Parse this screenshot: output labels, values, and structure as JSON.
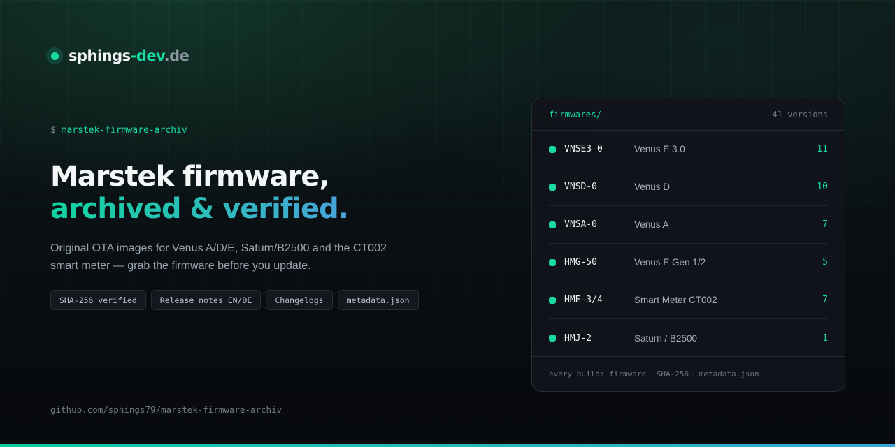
{
  "brand": {
    "part1": "sphings",
    "part2": "-dev",
    "part3": ".de"
  },
  "prompt": {
    "sign": "$",
    "command": "marstek-firmware-archiv"
  },
  "headline": {
    "line1": "Marstek firmware,",
    "line2": "archived & verified."
  },
  "lede": "Original OTA images for Venus A/D/E, Saturn/B2500 and the CT002 smart meter — grab the firmware before you update.",
  "tags": [
    "SHA-256 verified",
    "Release notes EN/DE",
    "Changelogs",
    "metadata.json"
  ],
  "repo_url": "github.com/sphings79/marstek-firmware-archiv",
  "card": {
    "title": "firmwares/",
    "count": "41 versions",
    "rows": [
      {
        "code": "VNSE3-0",
        "name": "Venus E 3.0",
        "count": "11"
      },
      {
        "code": "VNSD-0",
        "name": "Venus D",
        "count": "10"
      },
      {
        "code": "VNSA-0",
        "name": "Venus A",
        "count": "7"
      },
      {
        "code": "HMG-50",
        "name": "Venus E Gen 1/2",
        "count": "5"
      },
      {
        "code": "HME-3/4",
        "name": "Smart Meter CT002",
        "count": "7"
      },
      {
        "code": "HMJ-2",
        "name": "Saturn / B2500",
        "count": "1"
      }
    ],
    "footer": {
      "label": "every build:",
      "items": [
        "firmware",
        "SHA-256",
        "metadata.json"
      ],
      "separator": "·"
    }
  },
  "colors": {
    "accent": "#19d9a3",
    "accent_blue": "#48a3dd",
    "background": "#0a0e12"
  }
}
